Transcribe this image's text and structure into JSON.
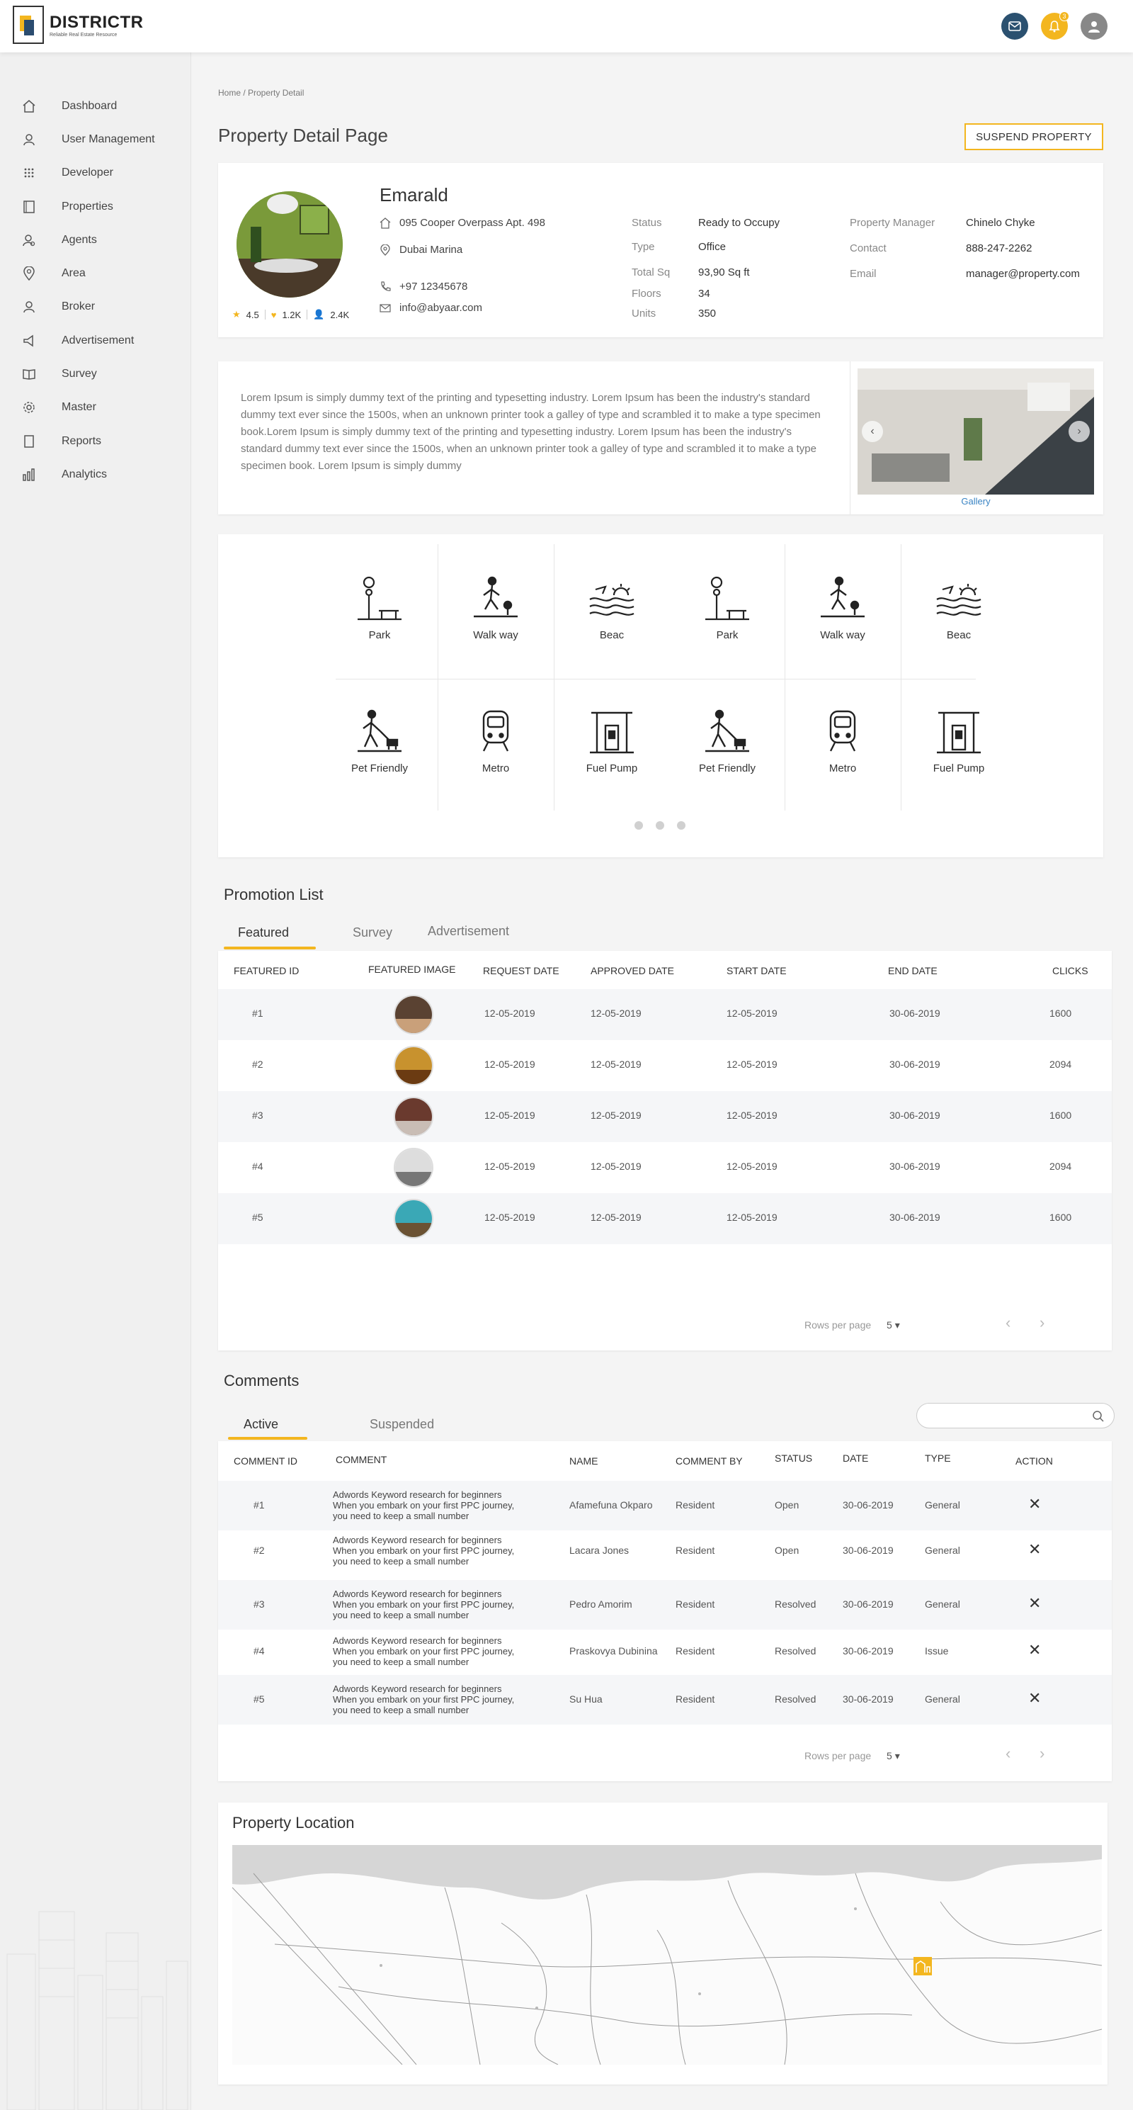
{
  "app": {
    "name": "DISTRICTR",
    "tagline": "Reliable Real Estate Resource",
    "notification_count": "3"
  },
  "colors": {
    "accent": "#f3b61f",
    "mail": "#2b5170",
    "link": "#3a84c4"
  },
  "sidebar": {
    "items": [
      {
        "label": "Dashboard",
        "icon": "home-icon"
      },
      {
        "label": "User Management",
        "icon": "user-icon"
      },
      {
        "label": "Developer",
        "icon": "grid-icon"
      },
      {
        "label": "Properties",
        "icon": "building-icon"
      },
      {
        "label": "Agents",
        "icon": "agent-icon"
      },
      {
        "label": "Area",
        "icon": "location-pin-icon"
      },
      {
        "label": "Broker",
        "icon": "broker-icon"
      },
      {
        "label": "Advertisement",
        "icon": "megaphone-icon"
      },
      {
        "label": "Survey",
        "icon": "book-icon"
      },
      {
        "label": "Master",
        "icon": "gear-icon"
      },
      {
        "label": "Reports",
        "icon": "report-icon"
      },
      {
        "label": "Analytics",
        "icon": "bar-chart-icon"
      }
    ]
  },
  "breadcrumb": "Home / Property Detail",
  "page_title": "Property Detail Page",
  "suspend_label": "SUSPEND PROPERTY",
  "property": {
    "name": "Emarald",
    "rating": "4.5",
    "likes": "1.2K",
    "followers": "2.4K",
    "address": "095 Cooper Overpass Apt. 498",
    "area": "Dubai Marina",
    "phone": "+97 12345678",
    "email": "info@abyaar.com",
    "details": [
      {
        "k": "Status",
        "v": "Ready to Occupy"
      },
      {
        "k": "Type",
        "v": "Office"
      },
      {
        "k": "Total Sq",
        "v": "93,90 Sq ft"
      },
      {
        "k": "Floors",
        "v": "34"
      },
      {
        "k": "Units",
        "v": "350"
      }
    ],
    "manager": [
      {
        "k": "Property Manager",
        "v": "Chinelo Chyke"
      },
      {
        "k": "Contact",
        "v": "888-247-2262"
      },
      {
        "k": "Email",
        "v": "manager@property.com"
      }
    ],
    "description": "Lorem Ipsum is simply dummy text of the printing and typesetting industry. Lorem Ipsum has been the industry's standard dummy text ever since the 1500s, when an unknown printer took a galley of type and scrambled it to make a type specimen book.Lorem Ipsum is simply dummy text of the printing and typesetting industry. Lorem Ipsum has been the industry's standard dummy text ever since the 1500s, when an unknown printer took a galley of type and scrambled it to make a type specimen book. Lorem Ipsum is simply dummy",
    "gallery_label": "Gallery"
  },
  "amenities": {
    "row1": [
      "Park",
      "Walk way",
      "Beac",
      "Park",
      "Walk way",
      "Beac"
    ],
    "row2": [
      "Pet Friendly",
      "Metro",
      "Fuel Pump",
      "Pet Friendly",
      "Metro",
      "Fuel Pump"
    ],
    "icons1": [
      "park-icon",
      "walkway-icon",
      "beach-icon",
      "park-icon",
      "walkway-icon",
      "beach-icon"
    ],
    "icons2": [
      "pet-friendly-icon",
      "metro-icon",
      "fuel-pump-icon",
      "pet-friendly-icon",
      "metro-icon",
      "fuel-pump-icon"
    ]
  },
  "promotion": {
    "title": "Promotion List",
    "tabs": [
      "Featured",
      "Survey",
      "Advertisement"
    ],
    "columns": [
      "FEATURED ID",
      "FEATURED IMAGE",
      "REQUEST DATE",
      "APPROVED DATE",
      "START DATE",
      "END DATE",
      "CLICKS"
    ],
    "rows": [
      {
        "id": "#1",
        "req": "12-05-2019",
        "appr": "12-05-2019",
        "start": "12-05-2019",
        "end": "30-06-2019",
        "clicks": "1600"
      },
      {
        "id": "#2",
        "req": "12-05-2019",
        "appr": "12-05-2019",
        "start": "12-05-2019",
        "end": "30-06-2019",
        "clicks": "2094"
      },
      {
        "id": "#3",
        "req": "12-05-2019",
        "appr": "12-05-2019",
        "start": "12-05-2019",
        "end": "30-06-2019",
        "clicks": "1600"
      },
      {
        "id": "#4",
        "req": "12-05-2019",
        "appr": "12-05-2019",
        "start": "12-05-2019",
        "end": "30-06-2019",
        "clicks": "2094"
      },
      {
        "id": "#5",
        "req": "12-05-2019",
        "appr": "12-05-2019",
        "start": "12-05-2019",
        "end": "30-06-2019",
        "clicks": "1600"
      }
    ],
    "rows_per_page_label": "Rows per page",
    "rows_per_page": "5"
  },
  "comments": {
    "title": "Comments",
    "tabs": [
      "Active",
      "Suspended"
    ],
    "columns": [
      "COMMENT ID",
      "COMMENT",
      "NAME",
      "COMMENT BY",
      "STATUS",
      "DATE",
      "TYPE",
      "ACTION"
    ],
    "comment_line1": "Adwords Keyword research for beginners",
    "comment_line2": "When you embark on your first PPC journey,",
    "comment_line3": "you need to keep a small number",
    "rows": [
      {
        "id": "#1",
        "name": "Afamefuna Okparo",
        "by": "Resident",
        "status": "Open",
        "date": "30-06-2019",
        "type": "General"
      },
      {
        "id": "#2",
        "name": "Lacara Jones",
        "by": "Resident",
        "status": "Open",
        "date": "30-06-2019",
        "type": "General"
      },
      {
        "id": "#3",
        "name": "Pedro Amorim",
        "by": "Resident",
        "status": "Resolved",
        "date": "30-06-2019",
        "type": "General"
      },
      {
        "id": "#4",
        "name": "Praskovya Dubinina",
        "by": "Resident",
        "status": "Resolved",
        "date": "30-06-2019",
        "type": "Issue"
      },
      {
        "id": "#5",
        "name": "Su Hua",
        "by": "Resident",
        "status": "Resolved",
        "date": "30-06-2019",
        "type": "General"
      }
    ],
    "rows_per_page_label": "Rows per page",
    "rows_per_page": "5"
  },
  "location": {
    "title": "Property Location"
  }
}
